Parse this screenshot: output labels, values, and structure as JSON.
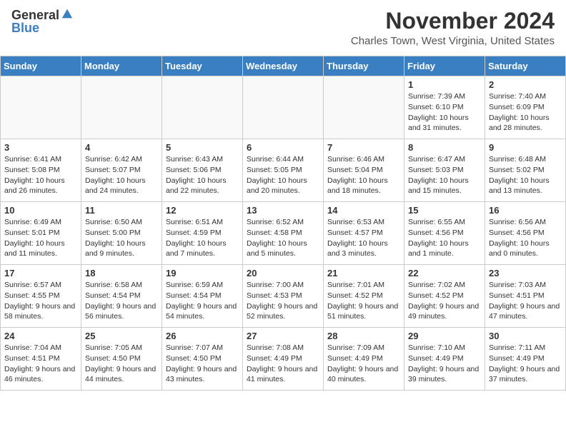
{
  "header": {
    "logo_general": "General",
    "logo_blue": "Blue",
    "month_title": "November 2024",
    "location": "Charles Town, West Virginia, United States"
  },
  "days_of_week": [
    "Sunday",
    "Monday",
    "Tuesday",
    "Wednesday",
    "Thursday",
    "Friday",
    "Saturday"
  ],
  "weeks": [
    [
      {
        "day": "",
        "info": ""
      },
      {
        "day": "",
        "info": ""
      },
      {
        "day": "",
        "info": ""
      },
      {
        "day": "",
        "info": ""
      },
      {
        "day": "",
        "info": ""
      },
      {
        "day": "1",
        "info": "Sunrise: 7:39 AM\nSunset: 6:10 PM\nDaylight: 10 hours and 31 minutes."
      },
      {
        "day": "2",
        "info": "Sunrise: 7:40 AM\nSunset: 6:09 PM\nDaylight: 10 hours and 28 minutes."
      }
    ],
    [
      {
        "day": "3",
        "info": "Sunrise: 6:41 AM\nSunset: 5:08 PM\nDaylight: 10 hours and 26 minutes."
      },
      {
        "day": "4",
        "info": "Sunrise: 6:42 AM\nSunset: 5:07 PM\nDaylight: 10 hours and 24 minutes."
      },
      {
        "day": "5",
        "info": "Sunrise: 6:43 AM\nSunset: 5:06 PM\nDaylight: 10 hours and 22 minutes."
      },
      {
        "day": "6",
        "info": "Sunrise: 6:44 AM\nSunset: 5:05 PM\nDaylight: 10 hours and 20 minutes."
      },
      {
        "day": "7",
        "info": "Sunrise: 6:46 AM\nSunset: 5:04 PM\nDaylight: 10 hours and 18 minutes."
      },
      {
        "day": "8",
        "info": "Sunrise: 6:47 AM\nSunset: 5:03 PM\nDaylight: 10 hours and 15 minutes."
      },
      {
        "day": "9",
        "info": "Sunrise: 6:48 AM\nSunset: 5:02 PM\nDaylight: 10 hours and 13 minutes."
      }
    ],
    [
      {
        "day": "10",
        "info": "Sunrise: 6:49 AM\nSunset: 5:01 PM\nDaylight: 10 hours and 11 minutes."
      },
      {
        "day": "11",
        "info": "Sunrise: 6:50 AM\nSunset: 5:00 PM\nDaylight: 10 hours and 9 minutes."
      },
      {
        "day": "12",
        "info": "Sunrise: 6:51 AM\nSunset: 4:59 PM\nDaylight: 10 hours and 7 minutes."
      },
      {
        "day": "13",
        "info": "Sunrise: 6:52 AM\nSunset: 4:58 PM\nDaylight: 10 hours and 5 minutes."
      },
      {
        "day": "14",
        "info": "Sunrise: 6:53 AM\nSunset: 4:57 PM\nDaylight: 10 hours and 3 minutes."
      },
      {
        "day": "15",
        "info": "Sunrise: 6:55 AM\nSunset: 4:56 PM\nDaylight: 10 hours and 1 minute."
      },
      {
        "day": "16",
        "info": "Sunrise: 6:56 AM\nSunset: 4:56 PM\nDaylight: 10 hours and 0 minutes."
      }
    ],
    [
      {
        "day": "17",
        "info": "Sunrise: 6:57 AM\nSunset: 4:55 PM\nDaylight: 9 hours and 58 minutes."
      },
      {
        "day": "18",
        "info": "Sunrise: 6:58 AM\nSunset: 4:54 PM\nDaylight: 9 hours and 56 minutes."
      },
      {
        "day": "19",
        "info": "Sunrise: 6:59 AM\nSunset: 4:54 PM\nDaylight: 9 hours and 54 minutes."
      },
      {
        "day": "20",
        "info": "Sunrise: 7:00 AM\nSunset: 4:53 PM\nDaylight: 9 hours and 52 minutes."
      },
      {
        "day": "21",
        "info": "Sunrise: 7:01 AM\nSunset: 4:52 PM\nDaylight: 9 hours and 51 minutes."
      },
      {
        "day": "22",
        "info": "Sunrise: 7:02 AM\nSunset: 4:52 PM\nDaylight: 9 hours and 49 minutes."
      },
      {
        "day": "23",
        "info": "Sunrise: 7:03 AM\nSunset: 4:51 PM\nDaylight: 9 hours and 47 minutes."
      }
    ],
    [
      {
        "day": "24",
        "info": "Sunrise: 7:04 AM\nSunset: 4:51 PM\nDaylight: 9 hours and 46 minutes."
      },
      {
        "day": "25",
        "info": "Sunrise: 7:05 AM\nSunset: 4:50 PM\nDaylight: 9 hours and 44 minutes."
      },
      {
        "day": "26",
        "info": "Sunrise: 7:07 AM\nSunset: 4:50 PM\nDaylight: 9 hours and 43 minutes."
      },
      {
        "day": "27",
        "info": "Sunrise: 7:08 AM\nSunset: 4:49 PM\nDaylight: 9 hours and 41 minutes."
      },
      {
        "day": "28",
        "info": "Sunrise: 7:09 AM\nSunset: 4:49 PM\nDaylight: 9 hours and 40 minutes."
      },
      {
        "day": "29",
        "info": "Sunrise: 7:10 AM\nSunset: 4:49 PM\nDaylight: 9 hours and 39 minutes."
      },
      {
        "day": "30",
        "info": "Sunrise: 7:11 AM\nSunset: 4:49 PM\nDaylight: 9 hours and 37 minutes."
      }
    ]
  ]
}
